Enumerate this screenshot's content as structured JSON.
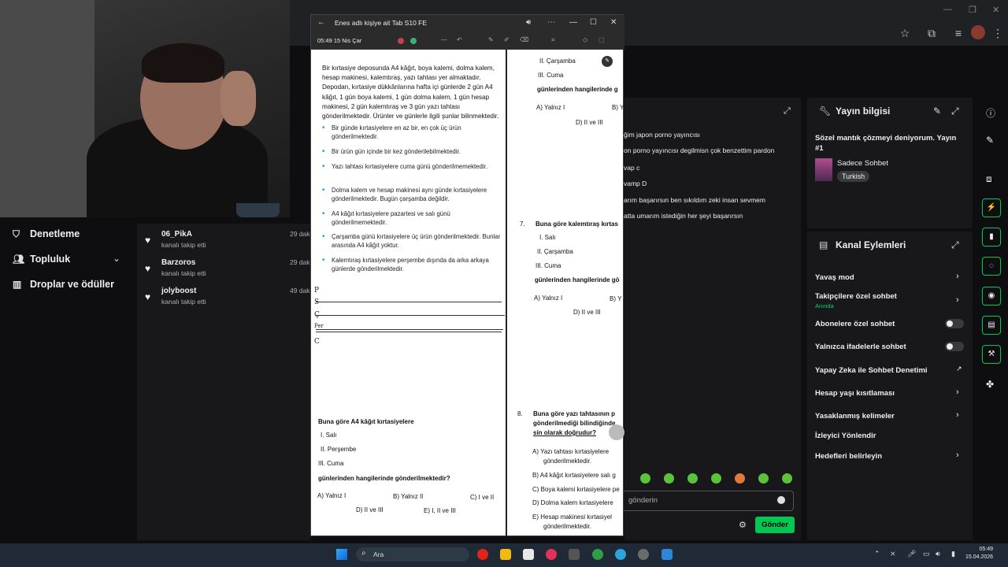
{
  "tablet_window": {
    "title": "Enes adlı kişiye ait Tab S10 FE",
    "status_time": "05:49 15 Nis Çar"
  },
  "left_nav": {
    "items": [
      {
        "label": "Denetleme",
        "icon": "shield-icon"
      },
      {
        "label": "Topluluk",
        "icon": "people-icon"
      },
      {
        "label": "Droplar ve ödüller",
        "icon": "gift-icon"
      }
    ]
  },
  "activity_feed": [
    {
      "name": "06_PikA",
      "action": "kanalı takip etti",
      "date": "29 dak"
    },
    {
      "name": "Barzoros",
      "action": "kanalı takip etti",
      "date": "29 dak"
    },
    {
      "name": "jolyboost",
      "action": "kanalı takip etti",
      "date": "49 dak"
    }
  ],
  "chat": {
    "messages": [
      "ğim japon porno yayıncısı",
      "on porno yayıncısı degilmisn çok benzettim pardon",
      "vap c",
      "vamp D",
      "arım başarırsın ben sıkıldım zeki insan sevmem",
      "atta umarım istediğin her şeyi başarırsın"
    ],
    "input_placeholder": "gönderin",
    "send_label": "Gönder"
  },
  "stream_info": {
    "header": "Yayın bilgisi",
    "title": "Sözel mantık çözmeyi deniyorum. Yayın #1",
    "category": "Sadece Sohbet",
    "tag": "Turkish"
  },
  "channel_actions": {
    "header": "Kanal Eylemleri",
    "items": [
      {
        "label": "Yavaş mod",
        "control": "chevron"
      },
      {
        "label": "Takipçilere özel sohbet",
        "sub": "Anında",
        "control": "chevron"
      },
      {
        "label": "Abonelere özel sohbet",
        "control": "toggle"
      },
      {
        "label": "Yalnızca ifadelerle sohbet",
        "control": "toggle"
      },
      {
        "label": "Yapay Zeka ile Sohbet Denetimi",
        "control": "external"
      },
      {
        "label": "Hesap yaşı kısıtlaması",
        "control": "chevron"
      },
      {
        "label": "Yasaklanmış kelimeler",
        "control": "chevron"
      },
      {
        "label": "İzleyici Yönlendir",
        "control": "none"
      },
      {
        "label": "Hedefleri belirleyin",
        "control": "chevron"
      }
    ]
  },
  "document": {
    "intro": "Bir kırtasiye deposunda A4 kâğıt, boya kalemi, dolma kalem, hesap makinesi, kalemtıraş, yazı tahtası yer almaktadır. Depodan, kırtasiye dükkânlarına hafta içi günlerde 2 gün A4 kâğıt, 1 gün boya kalemi, 1 gün dolma kalem, 1 gün hesap makinesi, 2 gün kalemtıraş ve 3 gün yazı tahtası gönderilmektedir. Ürünler ve günlerle ilgili şunlar bilinmektedir.",
    "bullets": [
      "Bir günde kırtasiyelere en az bir, en çok üç ürün gönderilmektedir.",
      "Bir ürün gün içinde bir kez gönderilebilmektedir.",
      "Yazı tahtası kırtasiyelere cuma günü gönderilmemektedir.",
      "Dolma kalem ve hesap makinesi aynı günde kırtasiyelere gönderilmektedir. Bugün çarşamba değildir.",
      "A4 kâğıt kırtasiyelere pazartesi ve salı günü gönderilmemektedir.",
      "Çarşamba günü kırtasiyelere üç ürün gönderilmektedir. Bunlar arasında A4 kâğıt yoktur.",
      "Kalemtıraş kırtasiyelere perşembe dışında da arka arkaya günlerde gönderilmektedir."
    ],
    "handwriting": [
      "P",
      "S",
      "Ç",
      "Per",
      "C"
    ],
    "q_left": {
      "title": "Buna göre A4 kâğıt kırtasiyelere",
      "items": [
        "I.  Salı",
        "II.  Perşembe",
        "III.  Cuma"
      ],
      "question": "günlerinden hangilerinde gönderilmektedir?",
      "answers": [
        "A) Yalnız I",
        "B) Yalnız II",
        "C) I ve II",
        "D) II ve III",
        "E) I, II ve III"
      ]
    },
    "q_top_right": {
      "items": [
        "II.  Çarşamba",
        "III.  Cuma"
      ],
      "question": "günlerinden hangilerinde g",
      "answers": [
        "A) Yalnız I",
        "B) Y",
        "D) II ve III"
      ]
    },
    "q7": {
      "num": "7.",
      "title": "Buna göre kalemtıraş kırtas",
      "items": [
        "I.  Salı",
        "II.  Çarşamba",
        "III.  Cuma"
      ],
      "question": "günlerinden hangilerinde gö",
      "answers": [
        "A) Yalnız I",
        "B) Y",
        "D) II ve III"
      ]
    },
    "q8": {
      "num": "8.",
      "lines": [
        "Buna göre yazı tahtasının p",
        "gönderilmediği bilindiğinde",
        "sin olarak doğrudur?"
      ],
      "answers": [
        "A)  Yazı  tahtası  kırtasiyelere",
        "gönderilmektedir.",
        "B)  A4 kâğıt kırtasiyelere salı g",
        "C)  Boya kalemi kırtasiyelere pe",
        "D)  Dolma kalem kırtasiyelere",
        "E)  Hesap makinesi kırtasiyel",
        "gönderilmektedir."
      ]
    }
  },
  "taskbar": {
    "search_label": "Ara",
    "time": "05:49",
    "date": "15.04.2026"
  },
  "colors": {
    "twitch_bg": "#0e0e10",
    "panel_bg": "#18181b",
    "accent_green": "#00c853",
    "text": "#efeff1",
    "muted": "#adadb8"
  }
}
